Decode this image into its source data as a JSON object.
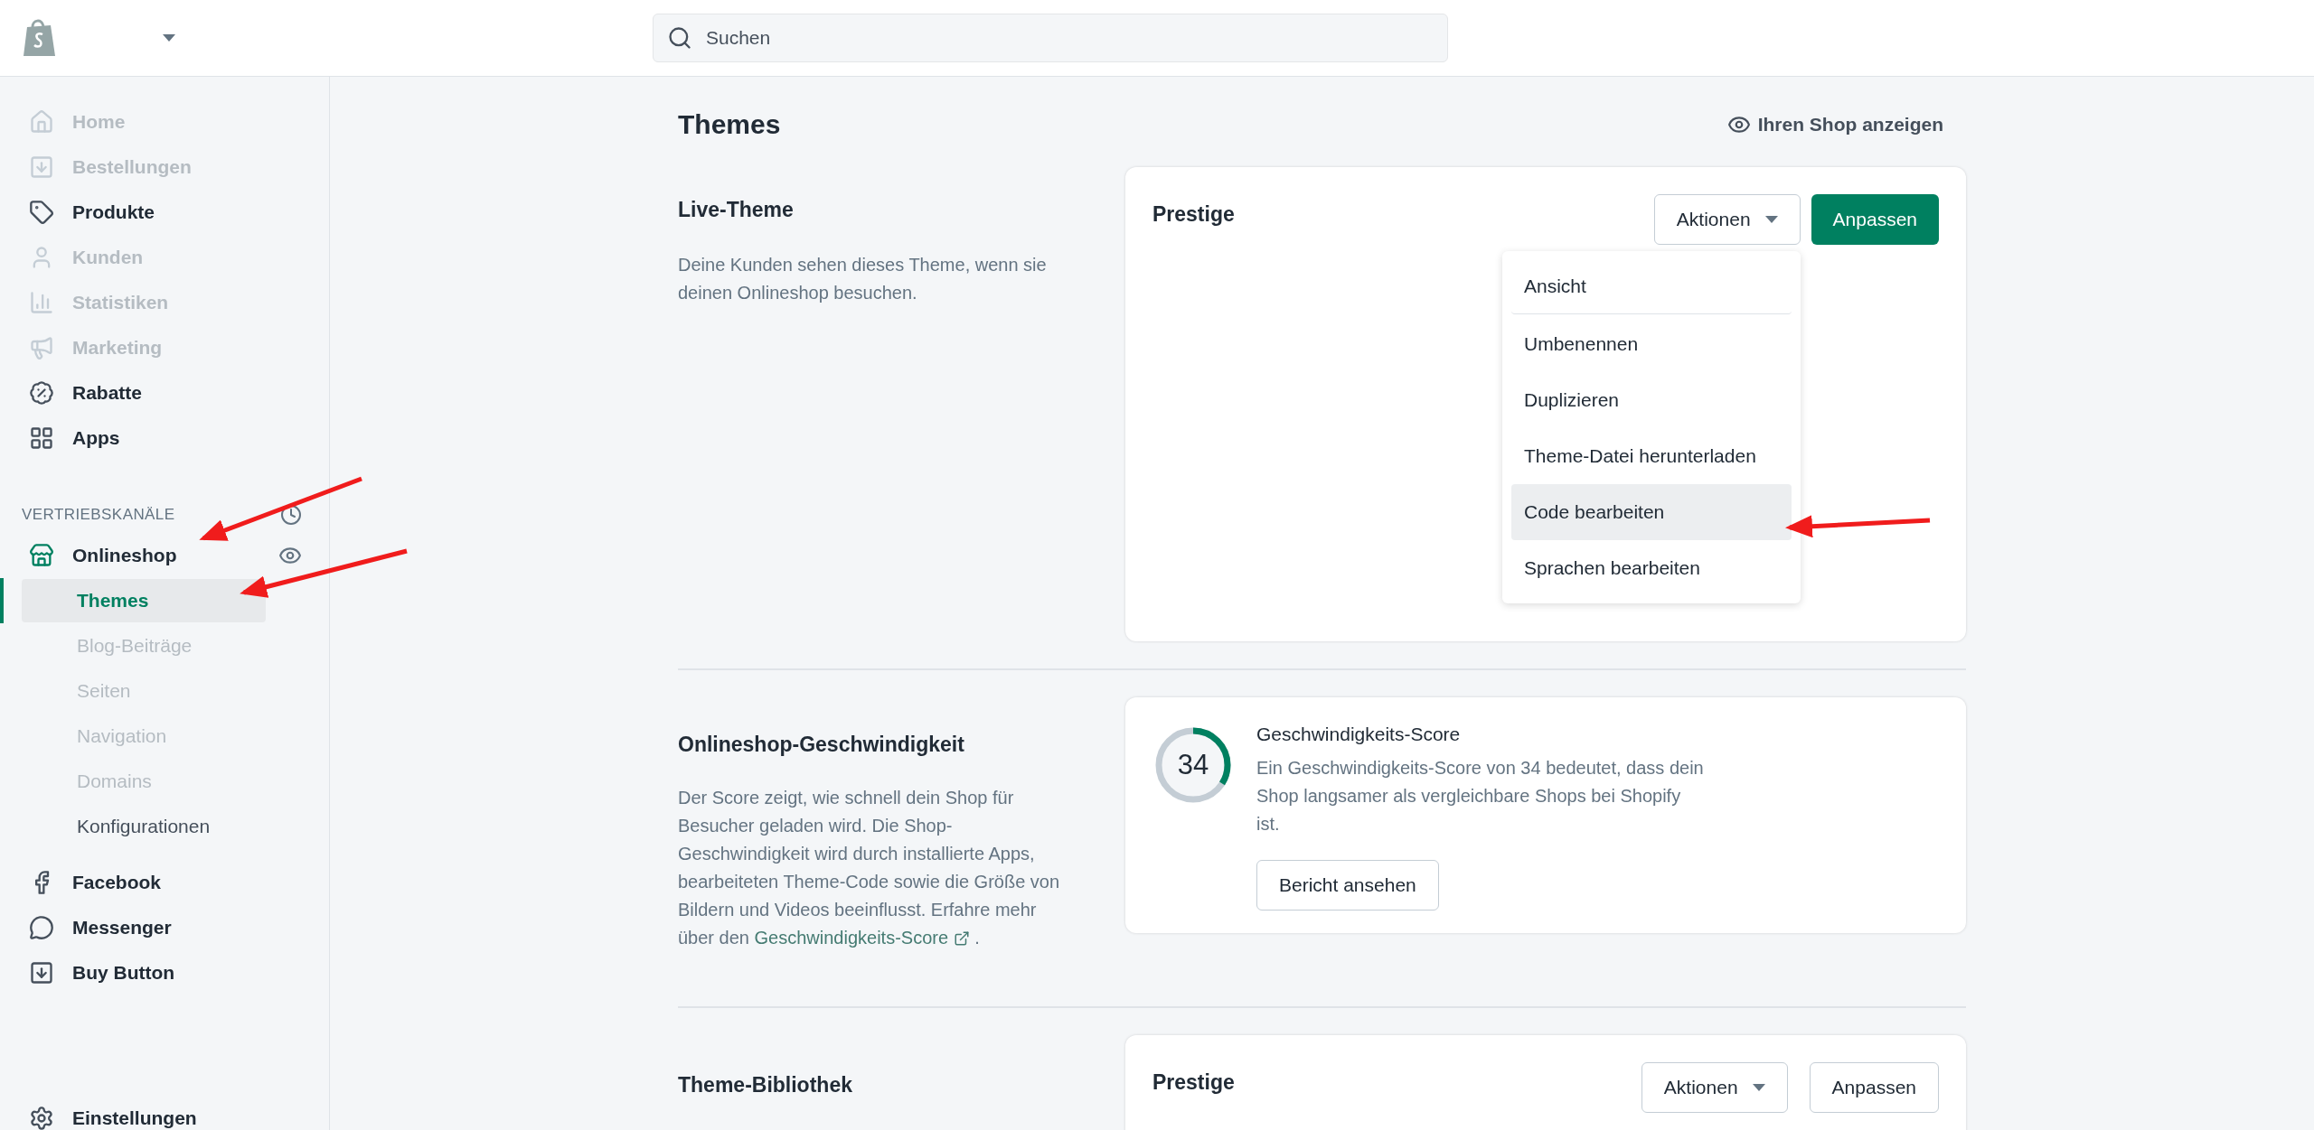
{
  "top_bar": {
    "search": {
      "placeholder": "Suchen"
    }
  },
  "sidebar": {
    "items": [
      {
        "label": "Home",
        "disabled": true
      },
      {
        "label": "Bestellungen",
        "disabled": true
      },
      {
        "label": "Produkte",
        "disabled": false
      },
      {
        "label": "Kunden",
        "disabled": true
      },
      {
        "label": "Statistiken",
        "disabled": true
      },
      {
        "label": "Marketing",
        "disabled": true
      },
      {
        "label": "Rabatte",
        "disabled": false
      },
      {
        "label": "Apps",
        "disabled": false
      }
    ],
    "section_title": "VERTRIEBSKANÄLE",
    "channels": [
      {
        "label": "Onlineshop",
        "children": [
          {
            "label": "Themes",
            "selected": true,
            "disabled": false
          },
          {
            "label": "Blog-Beiträge",
            "selected": false,
            "disabled": true
          },
          {
            "label": "Seiten",
            "selected": false,
            "disabled": true
          },
          {
            "label": "Navigation",
            "selected": false,
            "disabled": true
          },
          {
            "label": "Domains",
            "selected": false,
            "disabled": true
          },
          {
            "label": "Konfigurationen",
            "selected": false,
            "disabled": false
          }
        ]
      },
      {
        "label": "Facebook"
      },
      {
        "label": "Messenger"
      },
      {
        "label": "Buy Button"
      }
    ],
    "settings": "Einstellungen"
  },
  "page": {
    "title": "Themes",
    "view_shop": "Ihren Shop anzeigen"
  },
  "live_theme": {
    "heading": "Live-Theme",
    "description": "Deine Kunden sehen dieses Theme, wenn sie deinen Onlineshop besuchen.",
    "theme_name": "Prestige",
    "actions_button": "Aktionen",
    "customize_button": "Anpassen",
    "menu": [
      {
        "label": "Ansicht",
        "selected": false
      },
      {
        "label": "Umbenennen",
        "selected": false
      },
      {
        "label": "Duplizieren",
        "selected": false
      },
      {
        "label": "Theme-Datei herunterladen",
        "selected": false
      },
      {
        "label": "Code bearbeiten",
        "selected": true
      },
      {
        "label": "Sprachen bearbeiten",
        "selected": false
      }
    ]
  },
  "speed": {
    "heading": "Onlineshop-Geschwindigkeit",
    "description": "Der Score zeigt, wie schnell dein Shop für Besucher geladen wird. Die Shop-Geschwindigkeit wird durch installierte Apps, bearbeiteten Theme-Code sowie die Größe von Bildern und Videos beeinflusst. Erfahre mehr über den",
    "link": "Geschwindigkeits-Score",
    "after_link": ".",
    "score": "34",
    "level": 0.34,
    "score_title": "Geschwindigkeits-Score",
    "score_text": "Ein Geschwindigkeits-Score von 34 bedeutet, dass dein Shop langsamer als vergleichbare Shops bei Shopify ist.",
    "report_button": "Bericht ansehen"
  },
  "library": {
    "heading": "Theme-Bibliothek",
    "theme_name": "Prestige",
    "actions_button": "Aktionen",
    "customize_button": "Anpassen"
  }
}
